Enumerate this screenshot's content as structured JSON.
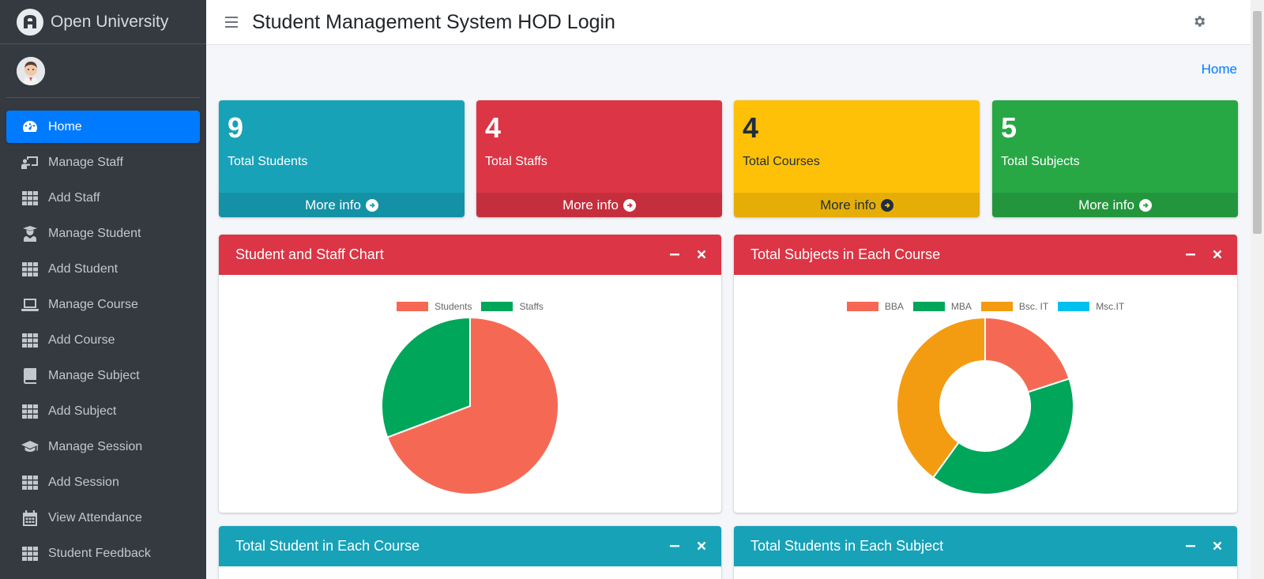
{
  "brand": {
    "name": "Open University"
  },
  "header": {
    "title": "Student Management System HOD Login"
  },
  "breadcrumb": {
    "home": "Home"
  },
  "sidebar": {
    "items": [
      {
        "label": "Home",
        "icon": "dashboard-icon",
        "active": true
      },
      {
        "label": "Manage Staff",
        "icon": "chalkboard-teacher-icon"
      },
      {
        "label": "Add Staff",
        "icon": "grid-icon"
      },
      {
        "label": "Manage Student",
        "icon": "user-graduate-icon"
      },
      {
        "label": "Add Student",
        "icon": "grid-icon"
      },
      {
        "label": "Manage Course",
        "icon": "laptop-icon"
      },
      {
        "label": "Add Course",
        "icon": "grid-icon"
      },
      {
        "label": "Manage Subject",
        "icon": "book-icon"
      },
      {
        "label": "Add Subject",
        "icon": "grid-icon"
      },
      {
        "label": "Manage Session",
        "icon": "graduation-cap-icon"
      },
      {
        "label": "Add Session",
        "icon": "grid-icon"
      },
      {
        "label": "View Attendance",
        "icon": "calendar-icon"
      },
      {
        "label": "Student Feedback",
        "icon": "grid-icon"
      }
    ]
  },
  "stats": [
    {
      "value": "9",
      "label": "Total Students",
      "more": "More info",
      "color": "#17a2b8"
    },
    {
      "value": "4",
      "label": "Total Staffs",
      "more": "More info",
      "color": "#dc3545"
    },
    {
      "value": "4",
      "label": "Total Courses",
      "more": "More info",
      "color": "#ffc107"
    },
    {
      "value": "5",
      "label": "Total Subjects",
      "more": "More info",
      "color": "#28a745"
    }
  ],
  "cards": [
    {
      "title": "Student and Staff Chart",
      "color": "#dc3545"
    },
    {
      "title": "Total Subjects in Each Course",
      "color": "#dc3545"
    },
    {
      "title": "Total Student in Each Course",
      "color": "#17a2b8"
    },
    {
      "title": "Total Students in Each Subject",
      "color": "#17a2b8"
    }
  ],
  "chart_data": [
    {
      "type": "pie",
      "categories": [
        "Students",
        "Staffs"
      ],
      "values": [
        9,
        4
      ],
      "colors": [
        "#f56954",
        "#00a65a"
      ],
      "legend": "top"
    },
    {
      "type": "pie",
      "variant": "doughnut",
      "categories": [
        "BBA",
        "MBA",
        "Bsc. IT",
        "Msc.IT"
      ],
      "values": [
        1,
        2,
        2,
        0
      ],
      "colors": [
        "#f56954",
        "#00a65a",
        "#f39c12",
        "#00c0ef"
      ],
      "legend": "top"
    }
  ]
}
